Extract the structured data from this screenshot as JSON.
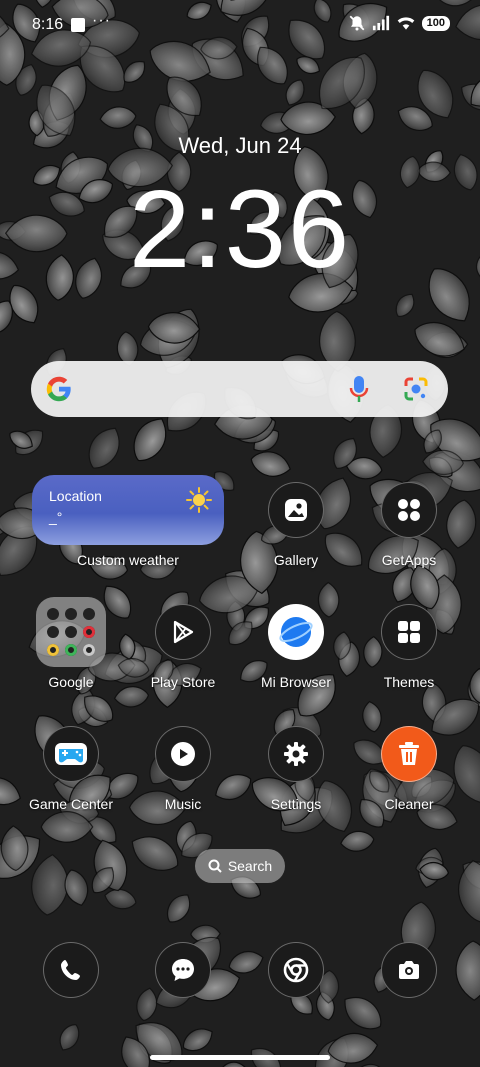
{
  "status_bar": {
    "time": "8:16",
    "more": "···",
    "battery": "100"
  },
  "lockscreen": {
    "date": "Wed, Jun 24",
    "time": "2:36"
  },
  "weather_widget": {
    "location": "Location",
    "temp": "_°",
    "label": "Custom weather"
  },
  "apps": {
    "gallery": "Gallery",
    "getapps": "GetApps",
    "google": "Google",
    "play_store": "Play Store",
    "mi_browser": "Mi Browser",
    "themes": "Themes",
    "game_center": "Game Center",
    "music": "Music",
    "settings": "Settings",
    "cleaner": "Cleaner"
  },
  "drawer_search": {
    "label": "Search"
  },
  "colors": {
    "weather_blue": "#4a60c0",
    "cleaner_orange": "#f25a1a",
    "browser_blue": "#1e7af0"
  }
}
